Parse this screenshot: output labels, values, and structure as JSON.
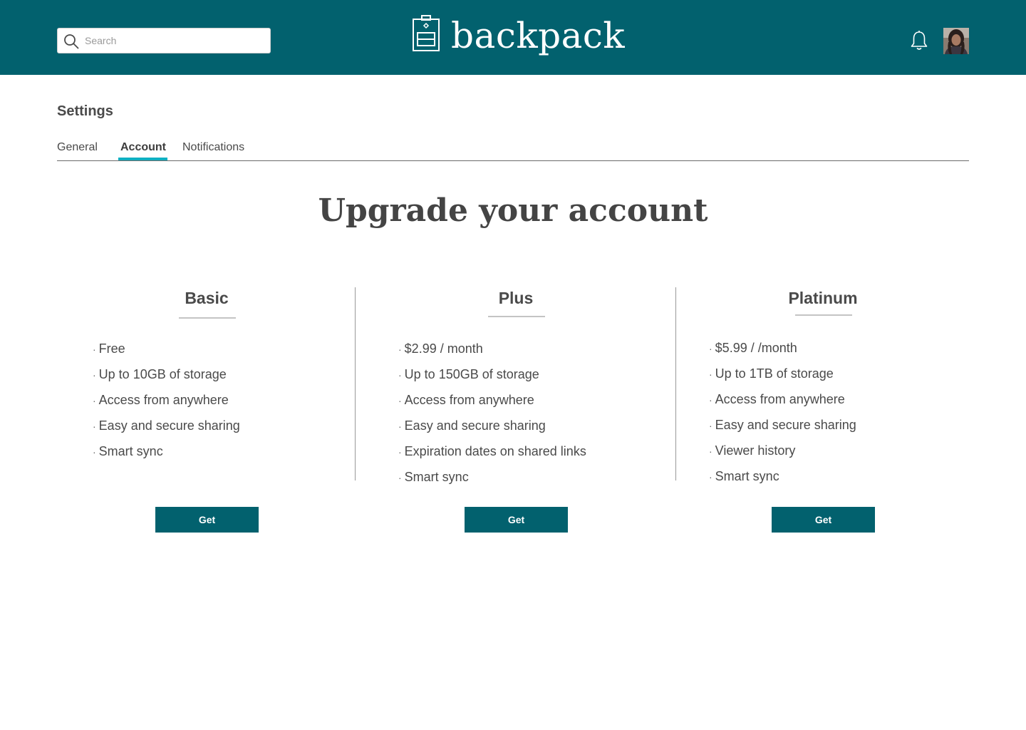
{
  "header": {
    "search_placeholder": "Search",
    "brand_name": "backpack",
    "background_color": "#02616e"
  },
  "settings": {
    "title": "Settings",
    "tabs": [
      {
        "label": "General",
        "active": false
      },
      {
        "label": "Account",
        "active": true
      },
      {
        "label": "Notifications",
        "active": false
      }
    ],
    "active_tab_color": "#0fb0c2"
  },
  "upgrade": {
    "title": "Upgrade your account",
    "plans": [
      {
        "name": "Basic",
        "features": [
          "Free",
          "Up to 10GB of storage",
          "Access from anywhere",
          "Easy and secure sharing",
          "Smart sync"
        ],
        "button_label": "Get"
      },
      {
        "name": "Plus",
        "features": [
          "$2.99 / month",
          "Up to 150GB of storage",
          "Access from anywhere",
          "Easy and secure sharing",
          "Expiration dates on shared links",
          "Smart sync"
        ],
        "button_label": "Get"
      },
      {
        "name": "Platinum",
        "features": [
          "$5.99 / /month",
          "Up to 1TB of storage",
          "Access from anywhere",
          "Easy and secure sharing",
          "Viewer history",
          "Smart sync"
        ],
        "button_label": "Get"
      }
    ]
  },
  "icons": {
    "search": "search-icon",
    "logo": "backpack-logo-icon",
    "notifications": "bell-icon",
    "user": "avatar"
  }
}
